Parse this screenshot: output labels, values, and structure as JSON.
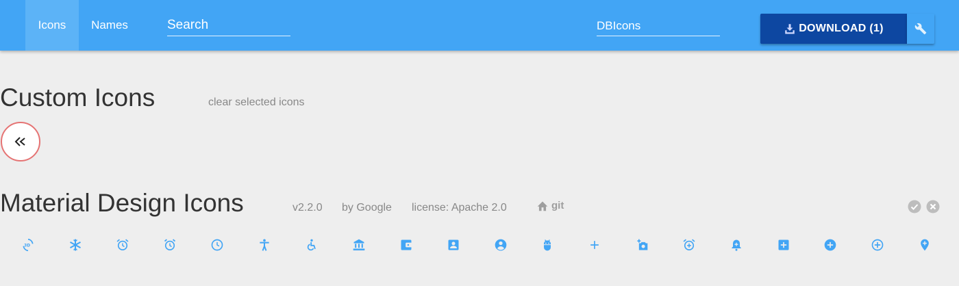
{
  "topbar": {
    "tabs": [
      {
        "label": "Icons",
        "active": true
      },
      {
        "label": "Names",
        "active": false
      }
    ],
    "search": {
      "placeholder": "Search",
      "value": ""
    },
    "font_name": {
      "value": "DBIcons"
    },
    "download": {
      "label": "DOWNLOAD (1)",
      "icon": "download-icon"
    },
    "settings": {
      "icon": "wrench-icon"
    }
  },
  "custom": {
    "title": "Custom Icons",
    "clear_label": "clear selected icons",
    "selected_icon": "double-chevron-left-icon"
  },
  "material": {
    "title": "Material Design Icons",
    "version": "v2.2.0",
    "author": "by Google",
    "license": "license: Apache 2.0",
    "git_label": "git",
    "icons": [
      "3d-rotation-icon",
      "ac-unit-icon",
      "access-alarm-icon",
      "access-alarms-icon",
      "access-time-icon",
      "accessibility-icon",
      "accessible-icon",
      "account-balance-icon",
      "account-balance-wallet-icon",
      "account-box-icon",
      "account-circle-icon",
      "adb-icon",
      "add-icon",
      "add-a-photo-icon",
      "add-alarm-icon",
      "add-alert-icon",
      "add-box-icon",
      "add-circle-icon",
      "add-circle-outline-icon",
      "add-location-icon"
    ]
  },
  "colors": {
    "topbar": "#42a5f5",
    "active_tab": "#5cb3f7",
    "download": "#0d47a1",
    "icon": "#42a5f5",
    "selected_ring": "#e57373",
    "background": "#eeeeee"
  }
}
